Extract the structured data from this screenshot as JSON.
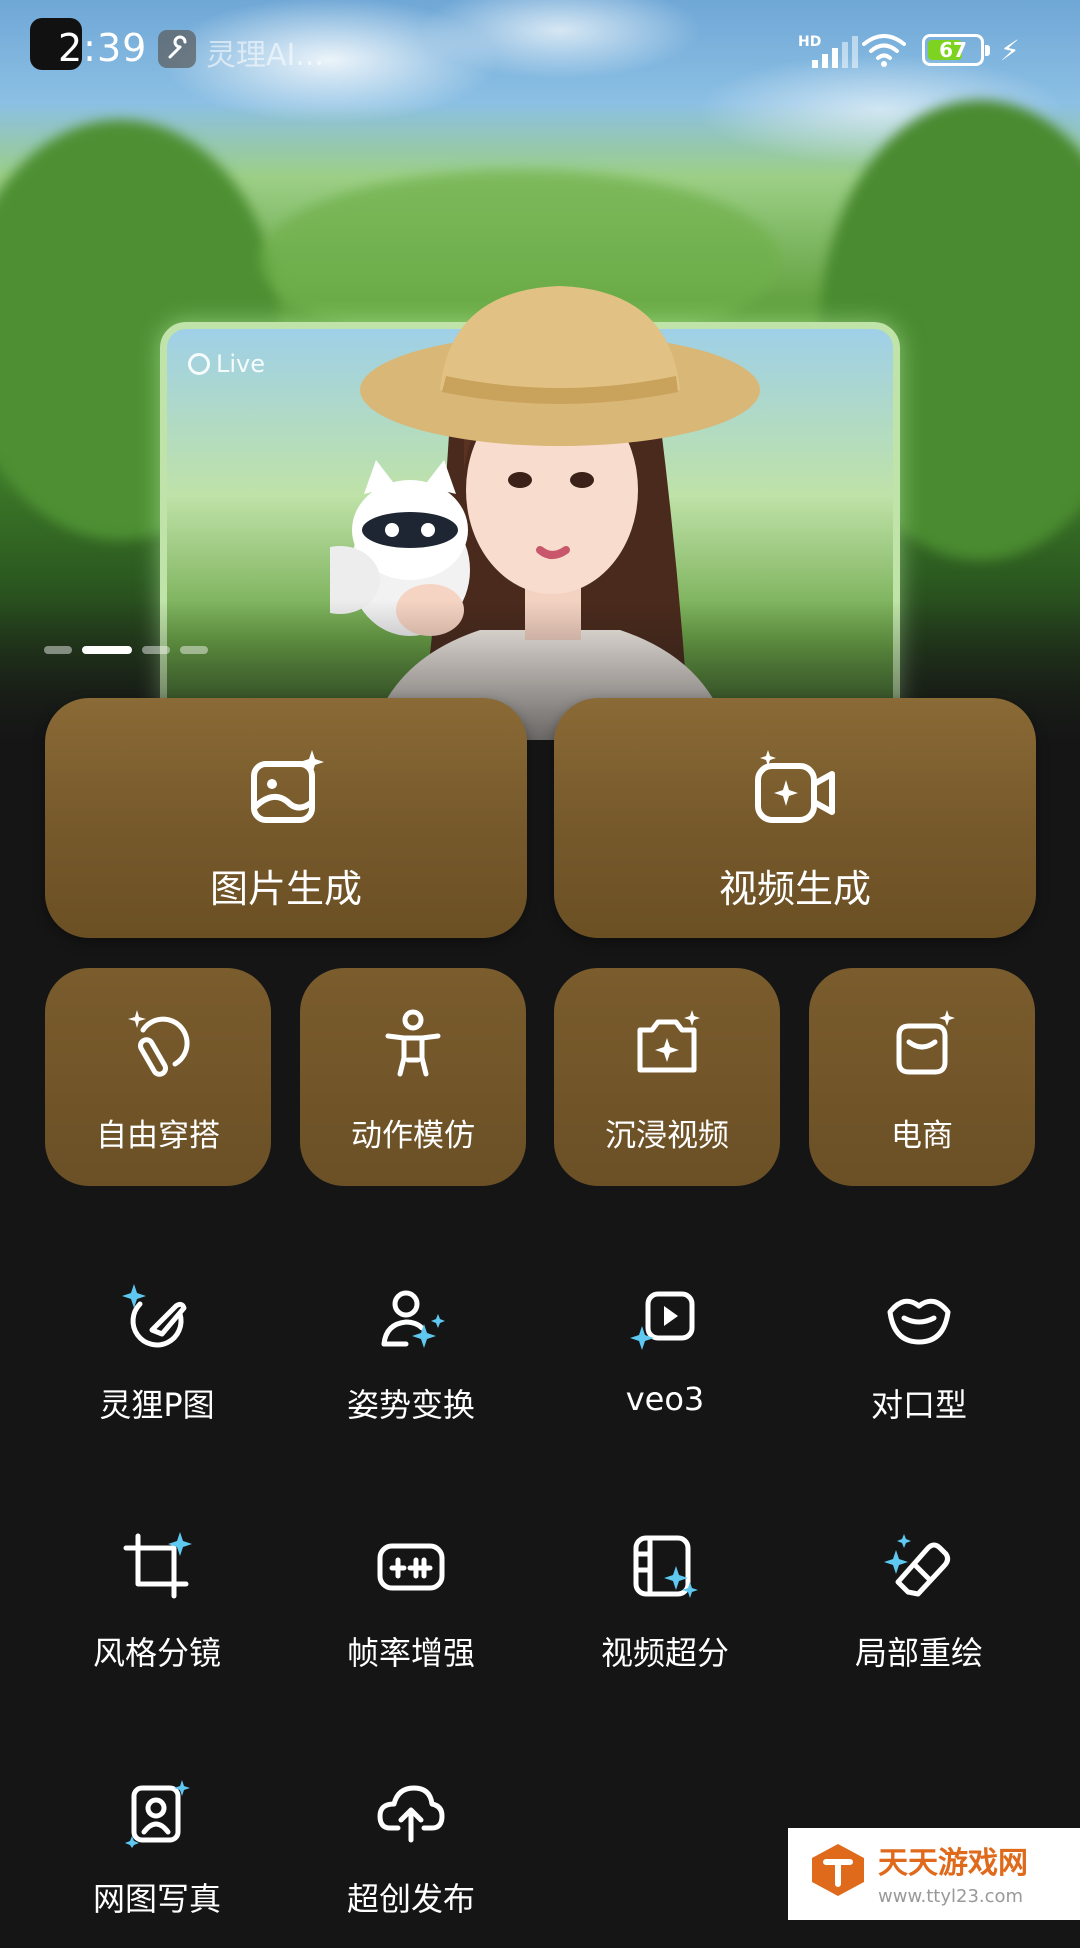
{
  "status_bar": {
    "time": "2:39",
    "notification_text": "灵理AI...",
    "network": "HD",
    "battery": "67",
    "battery_level": 0.67
  },
  "banner": {
    "live_label": "Live",
    "page_count": 4,
    "active_page": 2
  },
  "primary_actions": [
    {
      "label": "图片生成",
      "icon": "image-sparkle-icon"
    },
    {
      "label": "视频生成",
      "icon": "video-camera-sparkle-icon"
    }
  ],
  "feature_actions": [
    {
      "label": "自由穿搭",
      "icon": "magic-wand-icon"
    },
    {
      "label": "动作模仿",
      "icon": "person-pose-icon"
    },
    {
      "label": "沉浸视频",
      "icon": "camera-sparkle-icon"
    },
    {
      "label": "电商",
      "icon": "shopping-bag-sparkle-icon"
    }
  ],
  "tools": [
    {
      "label": "灵狸P图",
      "icon": "brush-sparkle-icon"
    },
    {
      "label": "姿势变换",
      "icon": "user-sparkle-icon"
    },
    {
      "label": "veo3",
      "icon": "video-play-sparkle-icon"
    },
    {
      "label": "对口型",
      "icon": "lips-icon"
    },
    {
      "label": "风格分镜",
      "icon": "crop-sparkle-icon"
    },
    {
      "label": "帧率增强",
      "icon": "frame-boost-icon"
    },
    {
      "label": "视频超分",
      "icon": "film-sparkle-icon"
    },
    {
      "label": "局部重绘",
      "icon": "eraser-sparkle-icon"
    },
    {
      "label": "网图写真",
      "icon": "portrait-sparkle-icon"
    },
    {
      "label": "超创发布",
      "icon": "cloud-upload-icon"
    }
  ],
  "watermark": {
    "name": "天天游戏网",
    "url": "www.ttyl23.com"
  },
  "colors": {
    "card_gold": "#7a5c2d",
    "sparkle": "#5ec8f0",
    "background": "#151516"
  }
}
